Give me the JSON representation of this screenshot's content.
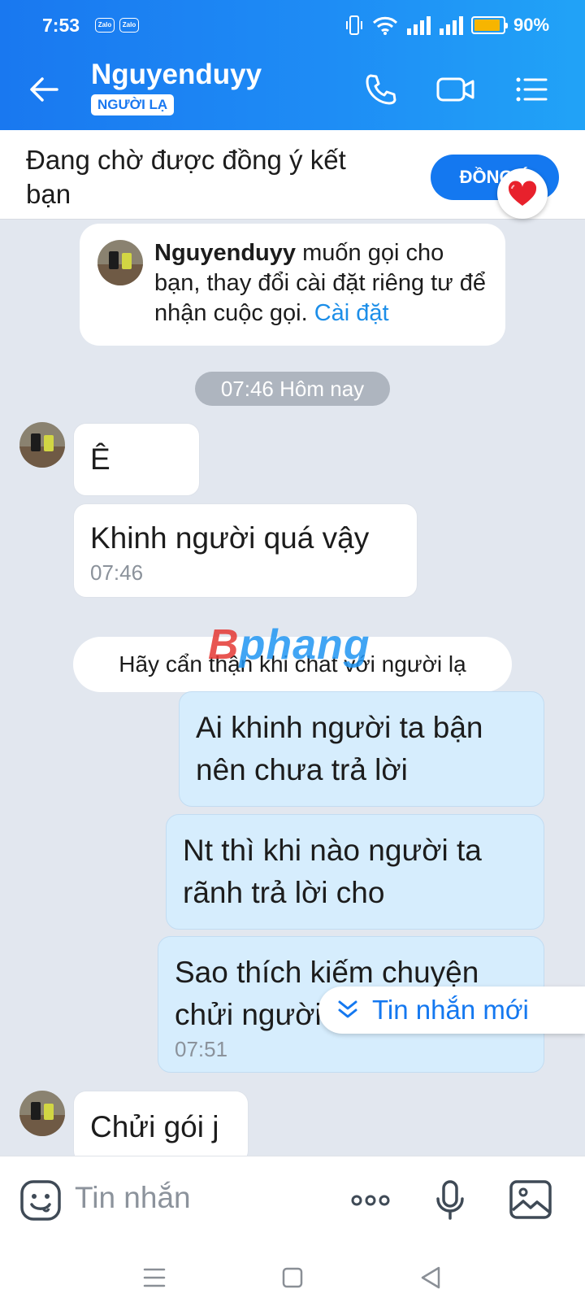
{
  "status_bar": {
    "time": "7:53",
    "notif_badges": [
      "Zalo",
      "Zalo"
    ],
    "battery": "90%",
    "battery_level": 0.9,
    "battery_color": "#f7b500"
  },
  "header": {
    "contact_name": "Nguyenduyy",
    "badge": "NGƯỜI LẠ",
    "icons": [
      "back-arrow-icon",
      "phone-icon",
      "video-call-icon",
      "menu-icon"
    ],
    "bg_color": "#1978f0"
  },
  "friend_request": {
    "text": "Đang chờ được đồng ý kết bạn",
    "button_label": "ĐỒNG Ý"
  },
  "chat": {
    "system_notice": {
      "name": "Nguyenduyy",
      "text": " muốn gọi cho bạn, thay đổi cài đặt riêng tư để nhận cuộc gọi. ",
      "link": "Cài đặt"
    },
    "date_divider": "07:46 Hôm nay",
    "messages": [
      {
        "dir": "in",
        "text": "Ê",
        "time": ""
      },
      {
        "dir": "in",
        "text": "Khinh người quá vậy",
        "time": "07:46"
      },
      {
        "dir": "out",
        "text": "Ai khinh người ta bận nên chưa trả lời",
        "time": ""
      },
      {
        "dir": "out",
        "text": "Nt thì khi nào người ta rãnh trả lời cho",
        "time": ""
      },
      {
        "dir": "out",
        "text": "Sao thích kiếm chuyện chửi người khác vậy",
        "time": "07:51"
      },
      {
        "dir": "in",
        "text": "Chửi gói j",
        "time": ""
      }
    ],
    "warning": "Hãy cẩn thận khi chat với người lạ",
    "watermark_red": "B",
    "watermark_blue": "phang",
    "new_messages_label": "Tin nhắn mới"
  },
  "input": {
    "placeholder": "Tin nhắn",
    "icons": [
      "emoji-icon",
      "more-icon",
      "microphone-icon",
      "image-icon"
    ]
  },
  "nav": {
    "icons": [
      "recent-apps-icon",
      "home-icon",
      "back-nav-icon"
    ]
  }
}
